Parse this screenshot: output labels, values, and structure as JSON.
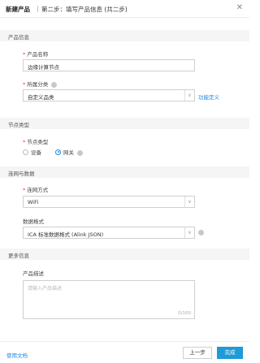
{
  "header": {
    "title": "新建产品",
    "separator": "|",
    "subtitle": "第二步：填写产品信息 (共二步)",
    "close_glyph": "✕"
  },
  "sections": {
    "product_info": "产品信息",
    "node_type": "节点类型",
    "networking": "连网与数据",
    "more_info": "更多信息"
  },
  "form": {
    "product_name": {
      "label": "产品名称",
      "value": "边缘计算节点"
    },
    "category": {
      "label": "所属分类",
      "value": "自定义品类",
      "link": "功能定义"
    },
    "node_type": {
      "label": "节点类型",
      "options": [
        "设备",
        "网关"
      ],
      "selected": "网关"
    },
    "network_method": {
      "label": "连网方式",
      "value": "WiFi"
    },
    "data_format": {
      "label": "数据格式",
      "value": "ICA 标准数据格式 (Alink JSON)"
    },
    "description": {
      "label": "产品描述",
      "placeholder": "请输入产品描述",
      "counter": "0/100"
    }
  },
  "footer": {
    "doc_link": "使用文档",
    "prev_button": "上一步",
    "done_button": "完成"
  },
  "colors": {
    "accent": "#1e88e5",
    "primary_button": "#1e9bd8",
    "required": "#e5333d",
    "section_bg": "#f5f5f6"
  }
}
